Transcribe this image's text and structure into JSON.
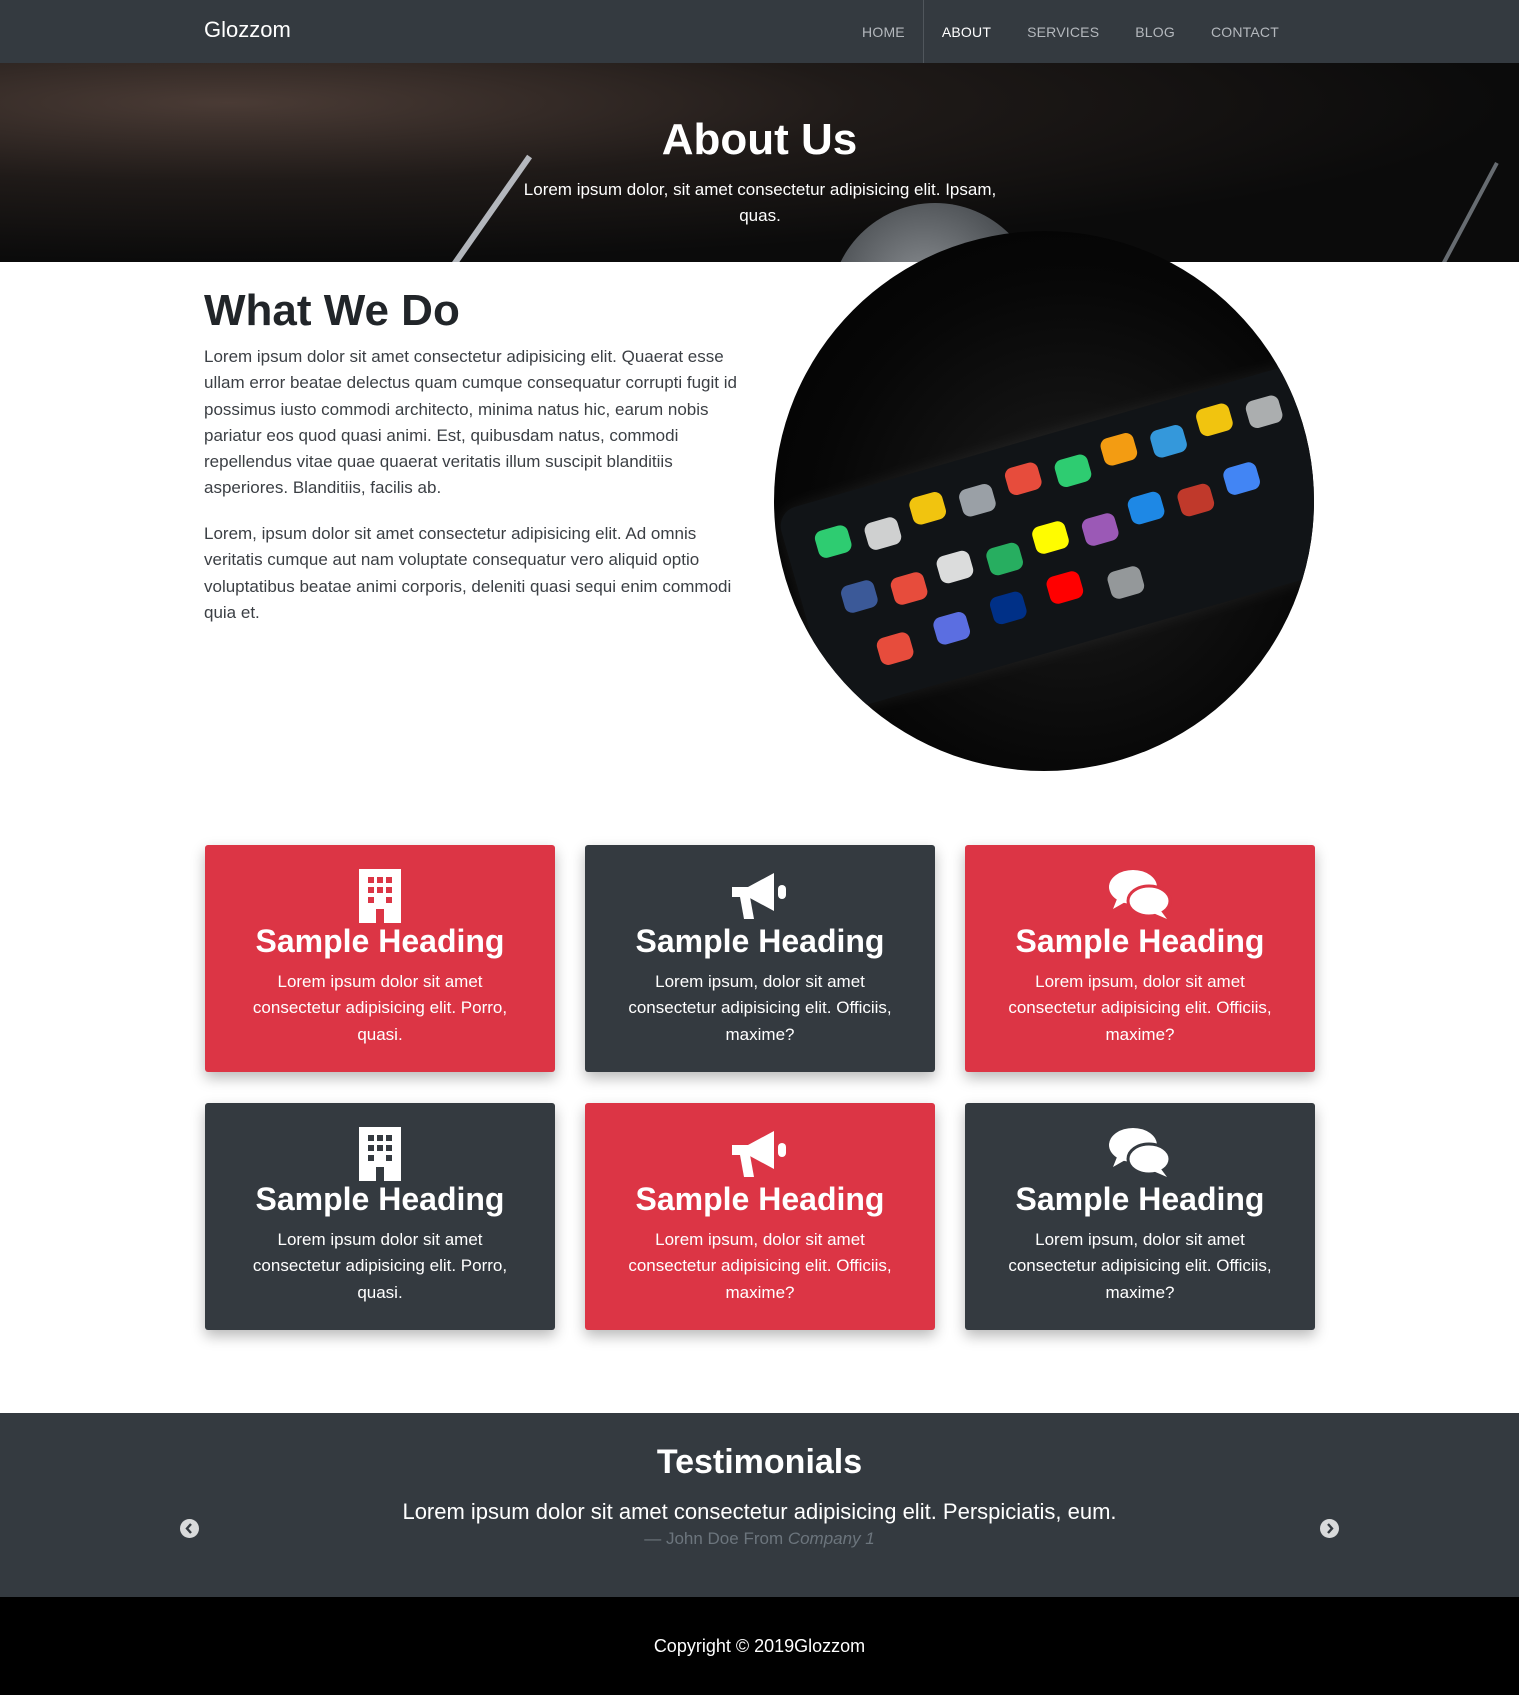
{
  "nav": {
    "brand": "Glozzom",
    "items": [
      {
        "label": "HOME",
        "active": false
      },
      {
        "label": "ABOUT",
        "active": true
      },
      {
        "label": "SERVICES",
        "active": false
      },
      {
        "label": "BLOG",
        "active": false
      },
      {
        "label": "CONTACT",
        "active": false
      }
    ]
  },
  "hero": {
    "title": "About Us",
    "text": "Lorem ipsum dolor, sit amet consectetur adipisicing elit. Ipsam, quas."
  },
  "what_we_do": {
    "heading": "What We Do",
    "p1": "Lorem ipsum dolor sit amet consectetur adipisicing elit. Quaerat esse ullam error beatae delectus quam cumque consequatur corrupti fugit id possimus iusto commodi architecto, minima natus hic, earum nobis pariatur eos quod quasi animi. Est, quibusdam natus, commodi repellendus vitae quae quaerat veritatis illum suscipit blanditiis asperiores. Blanditiis, facilis ab.",
    "p2": "Lorem, ipsum dolor sit amet consectetur adipisicing elit. Ad omnis veritatis cumque aut nam voluptate consequatur vero aliquid optio voluptatibus beatae animi corporis, deleniti quasi sequi enim commodi quia et.",
    "image_icon": "smartphone-apps-image"
  },
  "cards": [
    {
      "icon": "building-icon",
      "heading": "Sample Heading",
      "text": "Lorem ipsum dolor sit amet consectetur adipisicing elit. Porro, quasi.",
      "color": "red"
    },
    {
      "icon": "bullhorn-icon",
      "heading": "Sample Heading",
      "text": "Lorem ipsum, dolor sit amet consectetur adipisicing elit. Officiis, maxime?",
      "color": "dark"
    },
    {
      "icon": "comments-icon",
      "heading": "Sample Heading",
      "text": "Lorem ipsum, dolor sit amet consectetur adipisicing elit. Officiis, maxime?",
      "color": "red"
    },
    {
      "icon": "building-icon",
      "heading": "Sample Heading",
      "text": "Lorem ipsum dolor sit amet consectetur adipisicing elit. Porro, quasi.",
      "color": "dark"
    },
    {
      "icon": "bullhorn-icon",
      "heading": "Sample Heading",
      "text": "Lorem ipsum, dolor sit amet consectetur adipisicing elit. Officiis, maxime?",
      "color": "red"
    },
    {
      "icon": "comments-icon",
      "heading": "Sample Heading",
      "text": "Lorem ipsum, dolor sit amet consectetur adipisicing elit. Officiis, maxime?",
      "color": "dark"
    }
  ],
  "testimonials": {
    "heading": "Testimonials",
    "quote": "Lorem ipsum dolor sit amet consectetur adipisicing elit. Perspiciatis, eum.",
    "cite_prefix": "— John Doe From ",
    "cite_company": "Company 1",
    "prev_icon": "chevron-left-icon",
    "next_icon": "chevron-right-icon"
  },
  "footer": {
    "copyright": "Copyright © 2019Glozzom"
  },
  "colors": {
    "navbar": "#343a40",
    "red": "#dc3545",
    "dark": "#343a40",
    "footer": "#000000"
  }
}
